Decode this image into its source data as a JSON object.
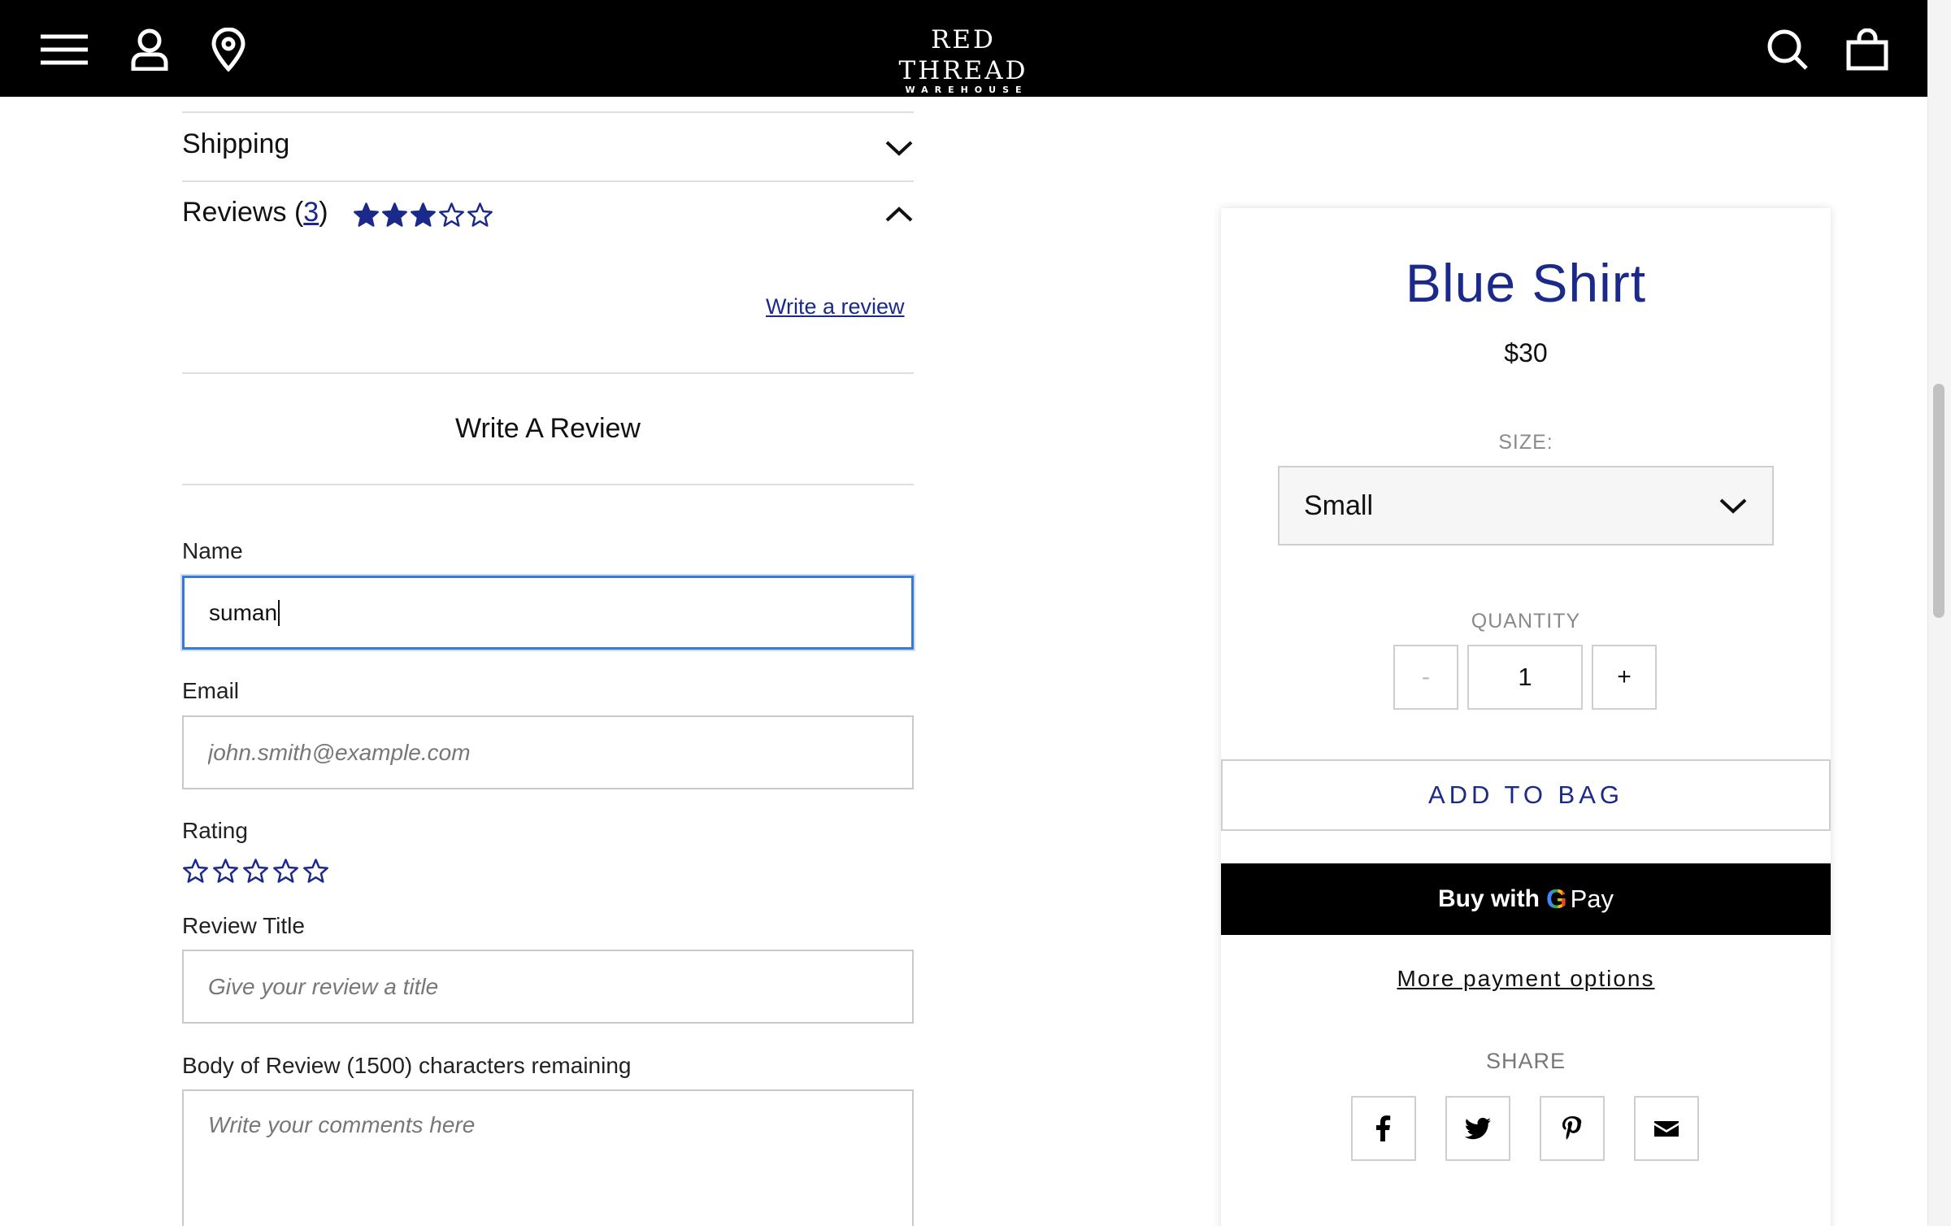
{
  "header": {
    "logo_main": "RED THREAD",
    "logo_sub": "WAREHOUSE",
    "icons": [
      "menu-icon",
      "account-icon",
      "location-icon",
      "search-icon",
      "bag-icon"
    ]
  },
  "accordion": {
    "shipping_label": "Shipping",
    "reviews_label": "Reviews",
    "reviews_open_paren": "(",
    "reviews_count": "3",
    "reviews_close_paren": ")",
    "average_rating": 3,
    "max_rating": 5
  },
  "review_form": {
    "write_link": "Write a review",
    "title": "Write A Review",
    "name_label": "Name",
    "name_value": "suman",
    "email_label": "Email",
    "email_placeholder": "john.smith@example.com",
    "rating_label": "Rating",
    "rating_value": 0,
    "review_title_label": "Review Title",
    "review_title_placeholder": "Give your review a title",
    "body_label": "Body of Review (1500) characters remaining",
    "body_placeholder": "Write your comments here"
  },
  "product": {
    "title": "Blue Shirt",
    "price": "$30",
    "size_label": "SIZE:",
    "size_value": "Small",
    "quantity_label": "QUANTITY",
    "quantity_value": "1",
    "minus_label": "-",
    "plus_label": "+",
    "add_to_bag": "ADD TO BAG",
    "gpay_buy_with": "Buy with",
    "gpay_g": "G",
    "gpay_pay": "Pay",
    "more_payment": "More payment options",
    "share_label": "SHARE",
    "share_icons": [
      "facebook-icon",
      "twitter-icon",
      "pinterest-icon",
      "email-icon"
    ]
  },
  "colors": {
    "accent": "#1b2a8a",
    "header_bg": "#000000",
    "focus_border": "#3a78d6"
  }
}
